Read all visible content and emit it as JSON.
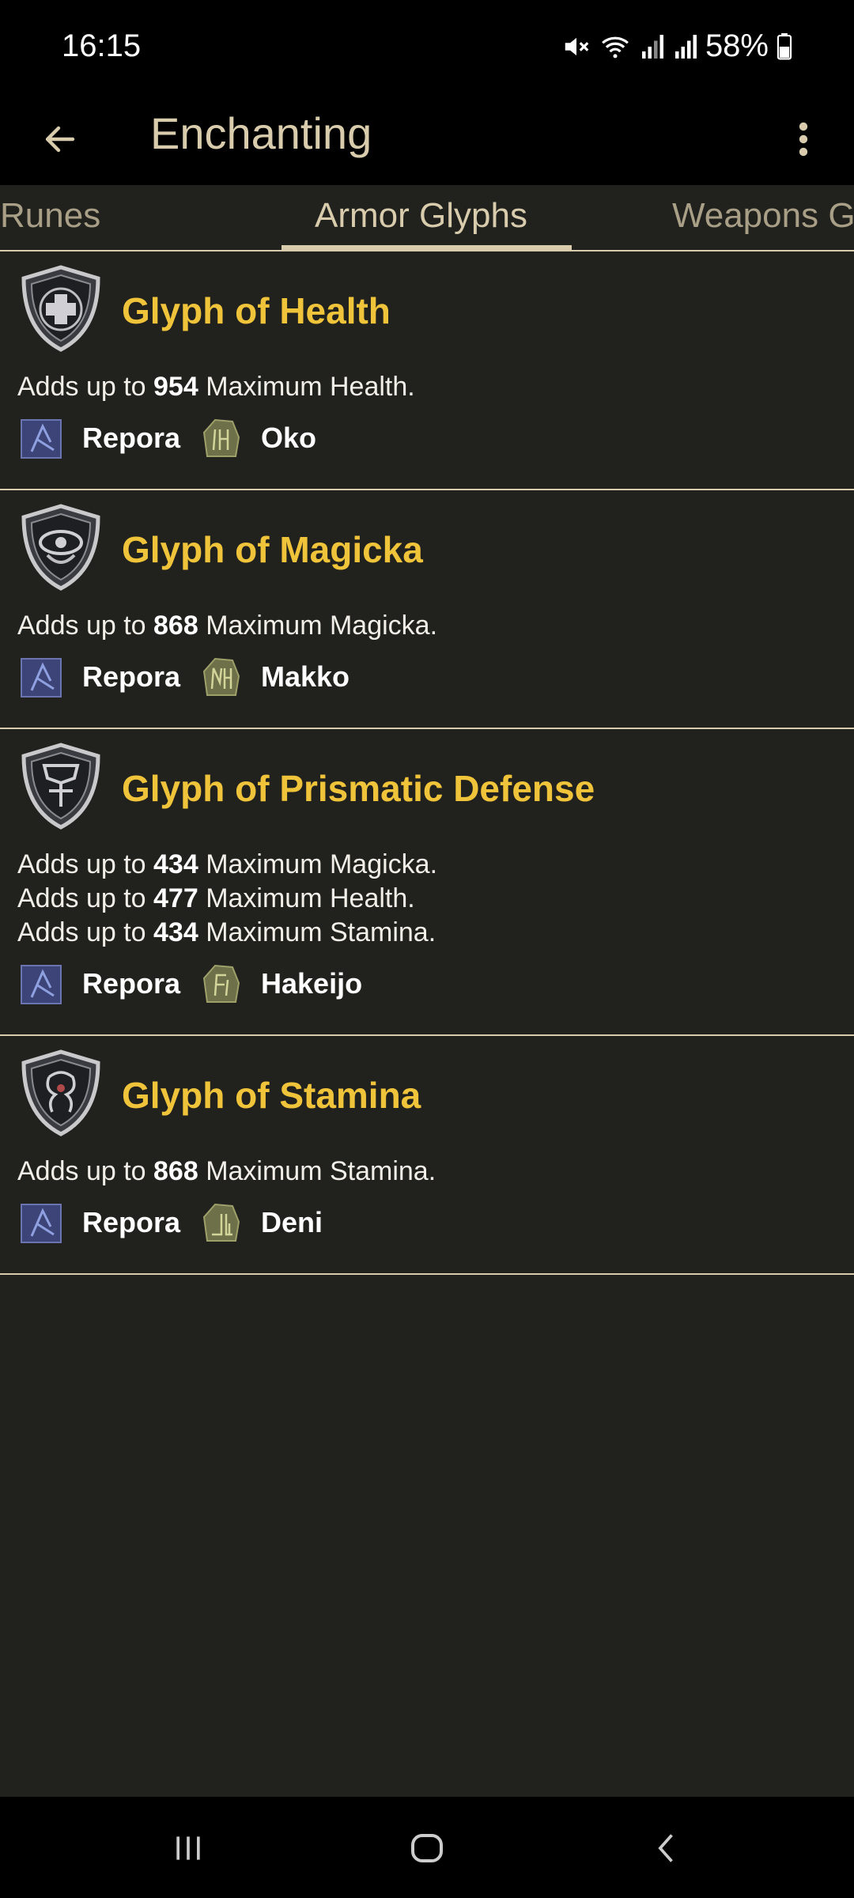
{
  "status": {
    "time": "16:15",
    "battery": "58%"
  },
  "app_bar": {
    "title": "Enchanting"
  },
  "tabs": [
    {
      "label": "Runes"
    },
    {
      "label": "Armor Glyphs"
    },
    {
      "label": "Weapons Glyphs"
    }
  ],
  "glyphs": [
    {
      "title": "Glyph of Health",
      "icon": "health-glyph-icon",
      "effects": [
        {
          "prefix": "Adds up to ",
          "value": "954",
          "suffix": " Maximum Health."
        }
      ],
      "runes": [
        {
          "label": "Repora",
          "icon": "repora-rune-icon"
        },
        {
          "label": "Oko",
          "icon": "oko-rune-icon"
        }
      ]
    },
    {
      "title": "Glyph of Magicka",
      "icon": "magicka-glyph-icon",
      "effects": [
        {
          "prefix": "Adds up to ",
          "value": "868",
          "suffix": " Maximum Magicka."
        }
      ],
      "runes": [
        {
          "label": "Repora",
          "icon": "repora-rune-icon"
        },
        {
          "label": "Makko",
          "icon": "makko-rune-icon"
        }
      ]
    },
    {
      "title": "Glyph of Prismatic Defense",
      "icon": "prismatic-defense-glyph-icon",
      "effects": [
        {
          "prefix": "Adds up to ",
          "value": "434",
          "suffix": " Maximum Magicka."
        },
        {
          "prefix": "Adds up to ",
          "value": "477",
          "suffix": " Maximum Health."
        },
        {
          "prefix": "Adds up to ",
          "value": "434",
          "suffix": " Maximum Stamina."
        }
      ],
      "runes": [
        {
          "label": "Repora",
          "icon": "repora-rune-icon"
        },
        {
          "label": "Hakeijo",
          "icon": "hakeijo-rune-icon"
        }
      ]
    },
    {
      "title": "Glyph of Stamina",
      "icon": "stamina-glyph-icon",
      "effects": [
        {
          "prefix": "Adds up to ",
          "value": "868",
          "suffix": " Maximum Stamina."
        }
      ],
      "runes": [
        {
          "label": "Repora",
          "icon": "repora-rune-icon"
        },
        {
          "label": "Deni",
          "icon": "deni-rune-icon"
        }
      ]
    }
  ],
  "colors": {
    "title_accent": "#f0c43a",
    "divider": "#d8ccad",
    "background": "#21211e"
  }
}
